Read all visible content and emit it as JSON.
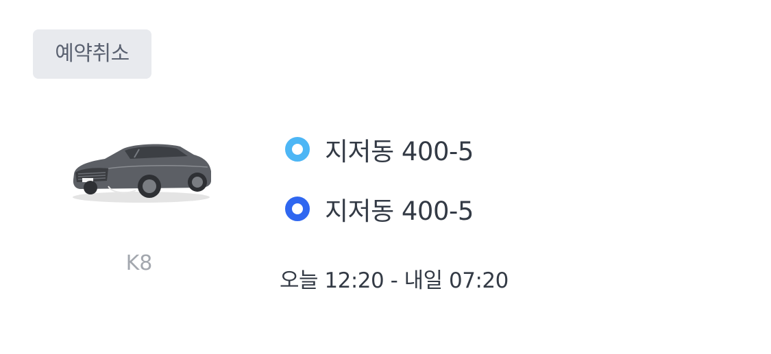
{
  "reservation": {
    "cancel_label": "예약취소",
    "car": {
      "name": "K8",
      "image_icon": "car-image"
    },
    "pickup_location": "지저동 400-5",
    "return_location": "지저동 400-5",
    "time_range": "오늘 12:20 - 내일 07:20",
    "colors": {
      "pickup_dot": "#4db6f5",
      "return_dot": "#2f67f0",
      "cancel_bg": "#e8eaee"
    }
  }
}
